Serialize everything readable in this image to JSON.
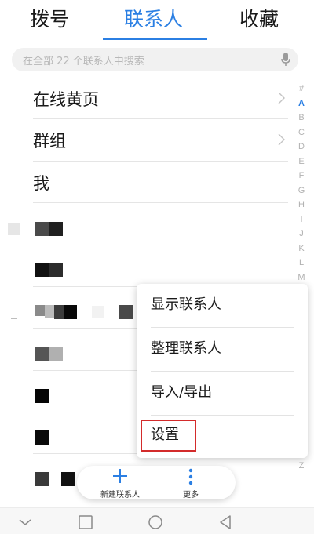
{
  "tabs": [
    {
      "label": "拨号"
    },
    {
      "label": "联系人"
    },
    {
      "label": "收藏"
    }
  ],
  "active_tab": "联系人",
  "accent_color": "#2b7fe3",
  "search": {
    "placeholder": "在全部 22 个联系人中搜索",
    "icon": "mic-icon"
  },
  "list": {
    "items": [
      {
        "label": "在线黄页",
        "icon": "chevron-right-icon"
      },
      {
        "label": "群组",
        "icon": "chevron-right-icon"
      },
      {
        "label": "我"
      }
    ]
  },
  "index_letters": [
    "#",
    "A",
    "B",
    "C",
    "D",
    "E",
    "F",
    "G",
    "H",
    "I",
    "J",
    "K",
    "L",
    "M"
  ],
  "index_active": "A",
  "index_last": "Z",
  "menu": {
    "items": [
      {
        "label": "显示联系人"
      },
      {
        "label": "整理联系人"
      },
      {
        "label": "导入/导出"
      },
      {
        "label": "设置"
      }
    ],
    "highlighted": "设置",
    "highlight_color": "#d32b2b"
  },
  "fab": {
    "new_contact": {
      "label": "新建联系人",
      "icon": "plus-icon"
    },
    "more": {
      "label": "更多",
      "icon": "more-vertical-icon"
    }
  },
  "navbar": {
    "icons": [
      "chevron-down-icon",
      "square-icon",
      "circle-icon",
      "triangle-back-icon"
    ]
  }
}
